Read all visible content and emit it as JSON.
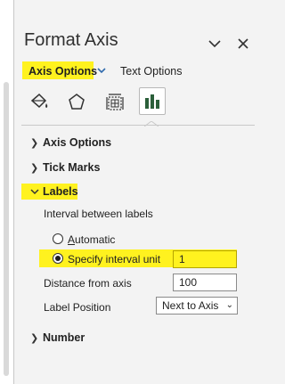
{
  "colors": {
    "highlight": "#fff21f",
    "accent": "#2f6aad",
    "panel_bg": "#f3f3f3"
  },
  "header": {
    "title": "Format Axis",
    "collapse_icon": "chevron-down-icon",
    "close_icon": "close-icon"
  },
  "tabs": {
    "axis_options": "Axis Options",
    "text_options": "Text Options"
  },
  "category_icons": [
    "fill-line-icon",
    "effects-icon",
    "size-properties-icon",
    "axis-options-icon"
  ],
  "sections": {
    "axis_options": "Axis Options",
    "tick_marks": "Tick Marks",
    "labels": "Labels",
    "number": "Number"
  },
  "labels_section": {
    "interval_heading": "Interval between labels",
    "automatic": "Automatic",
    "specify": "Specify interval unit",
    "specify_value": "1",
    "distance_label": "Distance from axis",
    "distance_value": "100",
    "position_label": "Label Position",
    "position_value": "Next to Axis",
    "selected_interval_option": "Specify interval unit"
  }
}
